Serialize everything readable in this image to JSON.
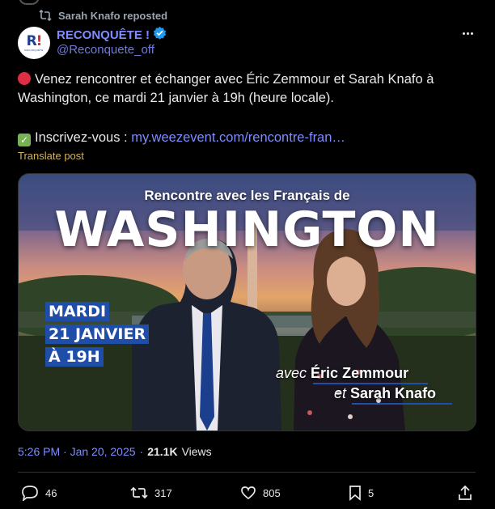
{
  "repost": {
    "label": "Sarah Knafo reposted"
  },
  "author": {
    "name": "RECONQUÊTE !",
    "handle": "@Reconquete_off",
    "avatar_mark": "R!",
    "avatar_caption": "RECONQUÊTE"
  },
  "post": {
    "line1": "Venez rencontrer et échanger avec Éric Zemmour et Sarah Knafo à",
    "line2": "Washington, ce mardi 21 janvier à 19h (heure locale).",
    "signup_label": "Inscrivez-vous : ",
    "signup_link": "my.weezevent.com/rencontre-fran…",
    "translate": "Translate post"
  },
  "card": {
    "subtitle": "Rencontre avec les Français de",
    "title": "WASHINGTON",
    "date_day": "MARDI",
    "date_date": "21 JANVIER",
    "date_time": "À 19H",
    "with_prefix": "avec",
    "with_name1": "Éric Zemmour",
    "with_and": "et",
    "with_name2": "Sarah Knafo"
  },
  "meta": {
    "time": "5:26 PM · Jan 20, 2025",
    "separator": "·",
    "views_count": "21.1K",
    "views_label": "Views"
  },
  "actions": {
    "replies": "46",
    "reposts": "317",
    "likes": "805",
    "bookmarks": "5"
  },
  "colors": {
    "link": "#7f8cff",
    "background": "#000000",
    "banner_blue": "#1f4ea8",
    "red_emoji": "#dd2e44",
    "check_emoji": "#77b255"
  }
}
